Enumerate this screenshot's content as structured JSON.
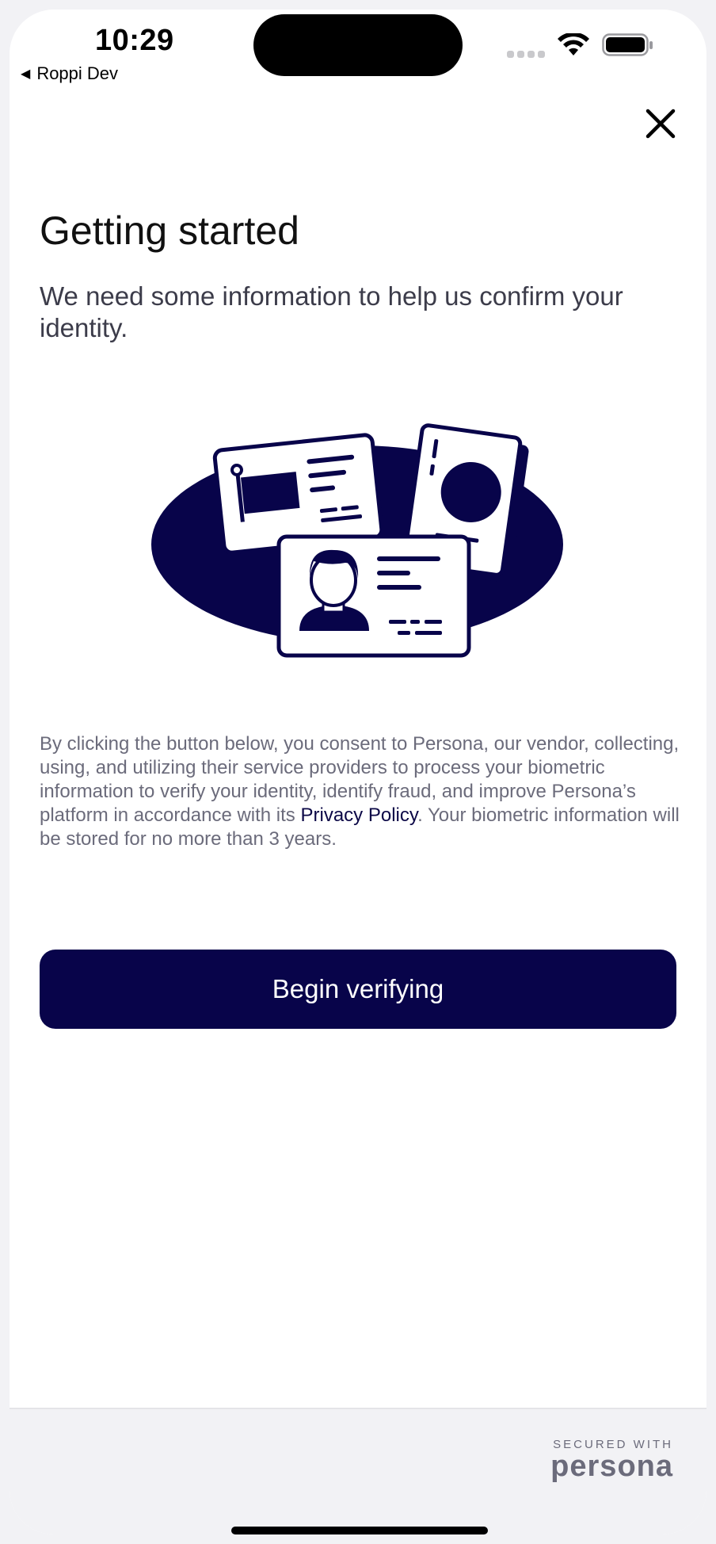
{
  "status_bar": {
    "time": "10:29",
    "back_app": "Roppi Dev",
    "signal_icon": "cellular-signal-icon",
    "wifi_icon": "wifi-icon",
    "battery_icon": "battery-icon"
  },
  "close_icon": "close-icon",
  "main": {
    "title": "Getting started",
    "subtitle": "We need some information to help us confirm your identity.",
    "illustration": "id-cards-illustration",
    "consent_pre": "By clicking the button below, you consent to Persona, our vendor, collecting, using, and utilizing their service providers to process your biometric information to verify your identity, identify fraud, and improve Persona’s platform in accordance with its ",
    "consent_link": "Privacy Policy",
    "consent_post": ". Your biometric information will be stored for no more than 3 years.",
    "button_label": "Begin verifying"
  },
  "footer": {
    "secured_label": "SECURED WITH",
    "brand": "persona"
  },
  "colors": {
    "primary": "#08044a",
    "text_muted": "#6b6b7b",
    "background": "#ffffff"
  }
}
